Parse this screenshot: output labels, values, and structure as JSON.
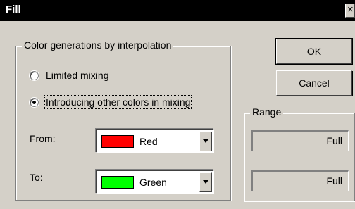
{
  "window": {
    "title": "Fill",
    "close_glyph": "×"
  },
  "interpolation": {
    "group_label": "Color generations by interpolation",
    "options": [
      {
        "label": "Limited mixing",
        "selected": false
      },
      {
        "label": "Introducing other colors in mixing",
        "selected": true
      }
    ],
    "from": {
      "label": "From:",
      "value": "Red",
      "swatch_color": "#ff0000"
    },
    "to": {
      "label": "To:",
      "value": "Green",
      "swatch_color": "#00ff00"
    }
  },
  "buttons": {
    "ok": "OK",
    "cancel": "Cancel"
  },
  "range": {
    "group_label": "Range",
    "fields": [
      "Full",
      "Full"
    ]
  },
  "icons": {
    "dropdown": "chevron-down-icon",
    "close": "close-icon"
  }
}
